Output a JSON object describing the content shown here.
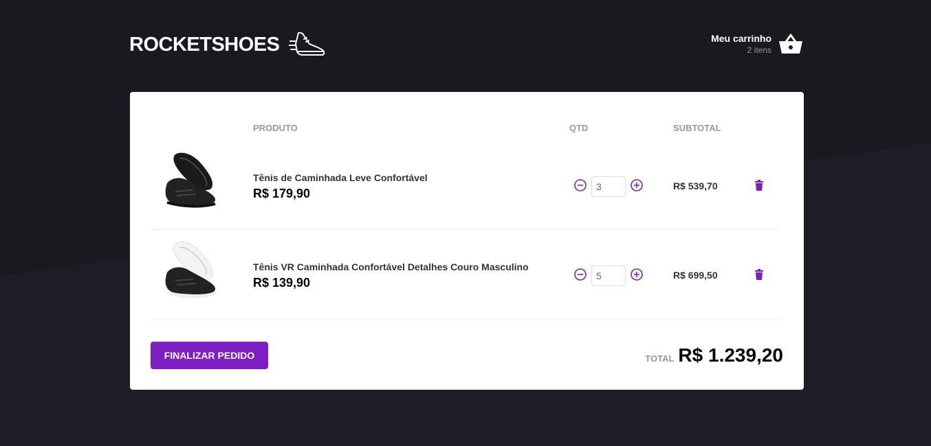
{
  "brand": {
    "name": "ROCKETSHOES"
  },
  "cart": {
    "title": "Meu carrinho",
    "count": "2 itens"
  },
  "table": {
    "headers": {
      "product": "PRODUTO",
      "qty": "QTD",
      "subtotal": "SUBTOTAL"
    },
    "items": [
      {
        "name": "Tênis de Caminhada Leve Confortável",
        "price": "R$ 179,90",
        "qty": "3",
        "subtotal": "R$ 539,70",
        "sole_color": "#1e1e1e"
      },
      {
        "name": "Tênis VR Caminhada Confortável Detalhes Couro Masculino",
        "price": "R$ 139,90",
        "qty": "5",
        "subtotal": "R$ 699,50",
        "sole_color": "#f2f2f2"
      }
    ]
  },
  "footer": {
    "finish_label": "FINALIZAR PEDIDO",
    "total_label": "TOTAL",
    "total_value": "R$ 1.239,20"
  },
  "colors": {
    "accent": "#7d1fc2",
    "background": "#191920",
    "panel": "#ffffff"
  },
  "icons": [
    "running-shoe-icon",
    "shopping-basket-icon",
    "minus-circle-icon",
    "plus-circle-icon",
    "trash-icon"
  ]
}
